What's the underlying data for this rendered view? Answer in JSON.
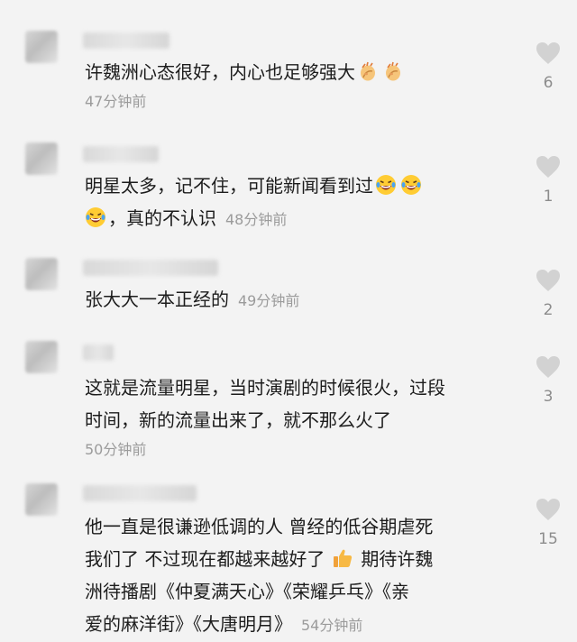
{
  "colors": {
    "background": "#f3f3f3",
    "text": "#1c1c1c",
    "meta": "#9b9b9b",
    "heart": "#d4d4d4"
  },
  "comments": [
    {
      "text": "许魏洲心态很好，内心也足够强大",
      "emojis": [
        "clapping-hands",
        "clapping-hands"
      ],
      "time": "47分钟前",
      "likes": "6"
    },
    {
      "text_line1": "明星太多，记不住，可能新闻看到过",
      "text_line2": "，真的不认识",
      "emojis": [
        "rolling-laughing",
        "rolling-laughing",
        "rolling-laughing"
      ],
      "time": "48分钟前",
      "likes": "1"
    },
    {
      "text": "张大大一本正经的",
      "time": "49分钟前",
      "likes": "2"
    },
    {
      "text_line1": "这就是流量明星，当时演剧的时候很火，过段",
      "text_line2": "时间，新的流量出来了，就不那么火了",
      "time": "50分钟前",
      "likes": "3"
    },
    {
      "text_line1": "他一直是很谦逊低调的人 曾经的低谷期虐死",
      "text_line2": "我们了 不过现在都越来越好了",
      "text_line3": "期待许魏",
      "text_line4": "洲待播剧《仲夏满天心》《荣耀乒乓》《亲",
      "text_line5": "爱的麻洋街》《大唐明月》",
      "emojis": [
        "thumbs-up"
      ],
      "time": "54分钟前",
      "likes": "15"
    }
  ]
}
